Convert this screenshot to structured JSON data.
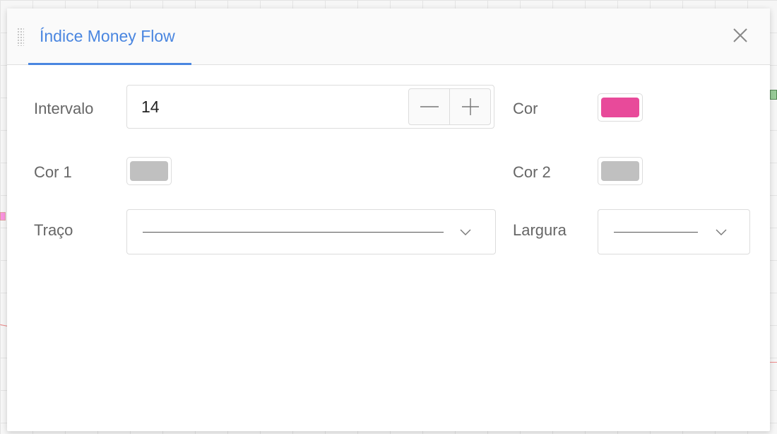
{
  "dialog": {
    "title": "Índice Money Flow"
  },
  "form": {
    "interval": {
      "label": "Intervalo",
      "value": "14"
    },
    "color": {
      "label": "Cor",
      "value": "#e84a9a"
    },
    "color1": {
      "label": "Cor 1",
      "value": "#c0c0c0"
    },
    "color2": {
      "label": "Cor 2",
      "value": "#c0c0c0"
    },
    "stroke": {
      "label": "Traço",
      "selected": "solid-line"
    },
    "width": {
      "label": "Largura",
      "selected": "thin-line"
    }
  },
  "icons": {
    "drag": "drag-handle-icon",
    "close": "close-icon",
    "minus": "minus-icon",
    "plus": "plus-icon",
    "chevron": "chevron-down-icon"
  }
}
